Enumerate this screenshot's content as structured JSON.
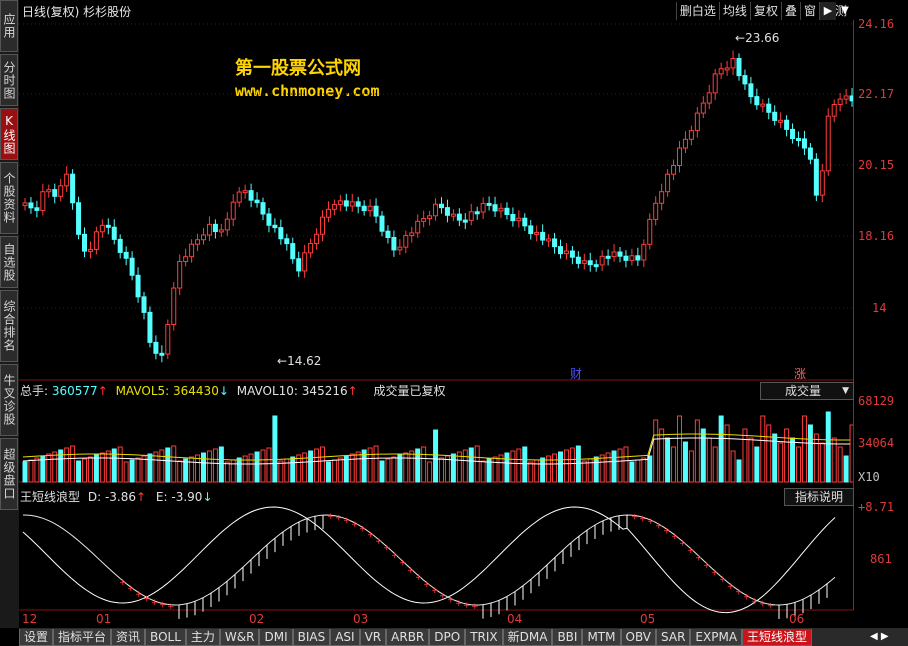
{
  "left_tabs": [
    {
      "label": "应用",
      "active": false
    },
    {
      "label": "分时图",
      "active": false
    },
    {
      "label": "K线图",
      "active": true
    },
    {
      "label": "个股资料",
      "active": false
    },
    {
      "label": "自选股",
      "active": false
    },
    {
      "label": "综合排名",
      "active": false
    },
    {
      "label": "牛叉诊股",
      "active": false
    },
    {
      "label": "超级盘口",
      "active": false
    }
  ],
  "header": {
    "title": "日线(复权) 杉杉股份"
  },
  "toolbar": [
    "删白选",
    "均线",
    "复权",
    "叠",
    "窗",
    "预测"
  ],
  "watermark": {
    "line1": "第一股票公式网",
    "line2": "www.chnmoney.com"
  },
  "price_panel": {
    "ylabels": [
      "24.16",
      "22.17",
      "20.15",
      "18.16",
      "14"
    ],
    "high_label": "23.66",
    "low_label": "14.62",
    "markers": [
      "财",
      "涨"
    ]
  },
  "volume_panel": {
    "total_label": "总手:",
    "total_value": "360577",
    "mavol5_label": "MAVOL5:",
    "mavol5_value": "364430",
    "mavol10_label": "MAVOL10:",
    "mavol10_value": "345216",
    "note": "成交量已复权",
    "selector": "成交量",
    "ylabels": [
      "68129",
      "34064",
      "X10"
    ]
  },
  "indicator_panel": {
    "name": "王短线浪型",
    "d_label": "D:",
    "d_value": "-3.86",
    "e_label": "E:",
    "e_value": "-3.90",
    "help_button": "指标说明",
    "ylabels": [
      "+8.71",
      "861"
    ]
  },
  "xaxis": [
    "12",
    "01",
    "02",
    "03",
    "04",
    "05",
    "06"
  ],
  "bottom_tabs": [
    "设置",
    "指标平台",
    "资讯",
    "BOLL",
    "主力",
    "W&R",
    "DMI",
    "BIAS",
    "ASI",
    "VR",
    "ARBR",
    "DPO",
    "TRIX",
    "新DMA",
    "BBI",
    "MTM",
    "OBV",
    "SAR",
    "EXPMA",
    "王短线浪型"
  ],
  "colors": {
    "up": "#ff3c3c",
    "down": "#54ffff",
    "accent": "#c8141a"
  }
}
